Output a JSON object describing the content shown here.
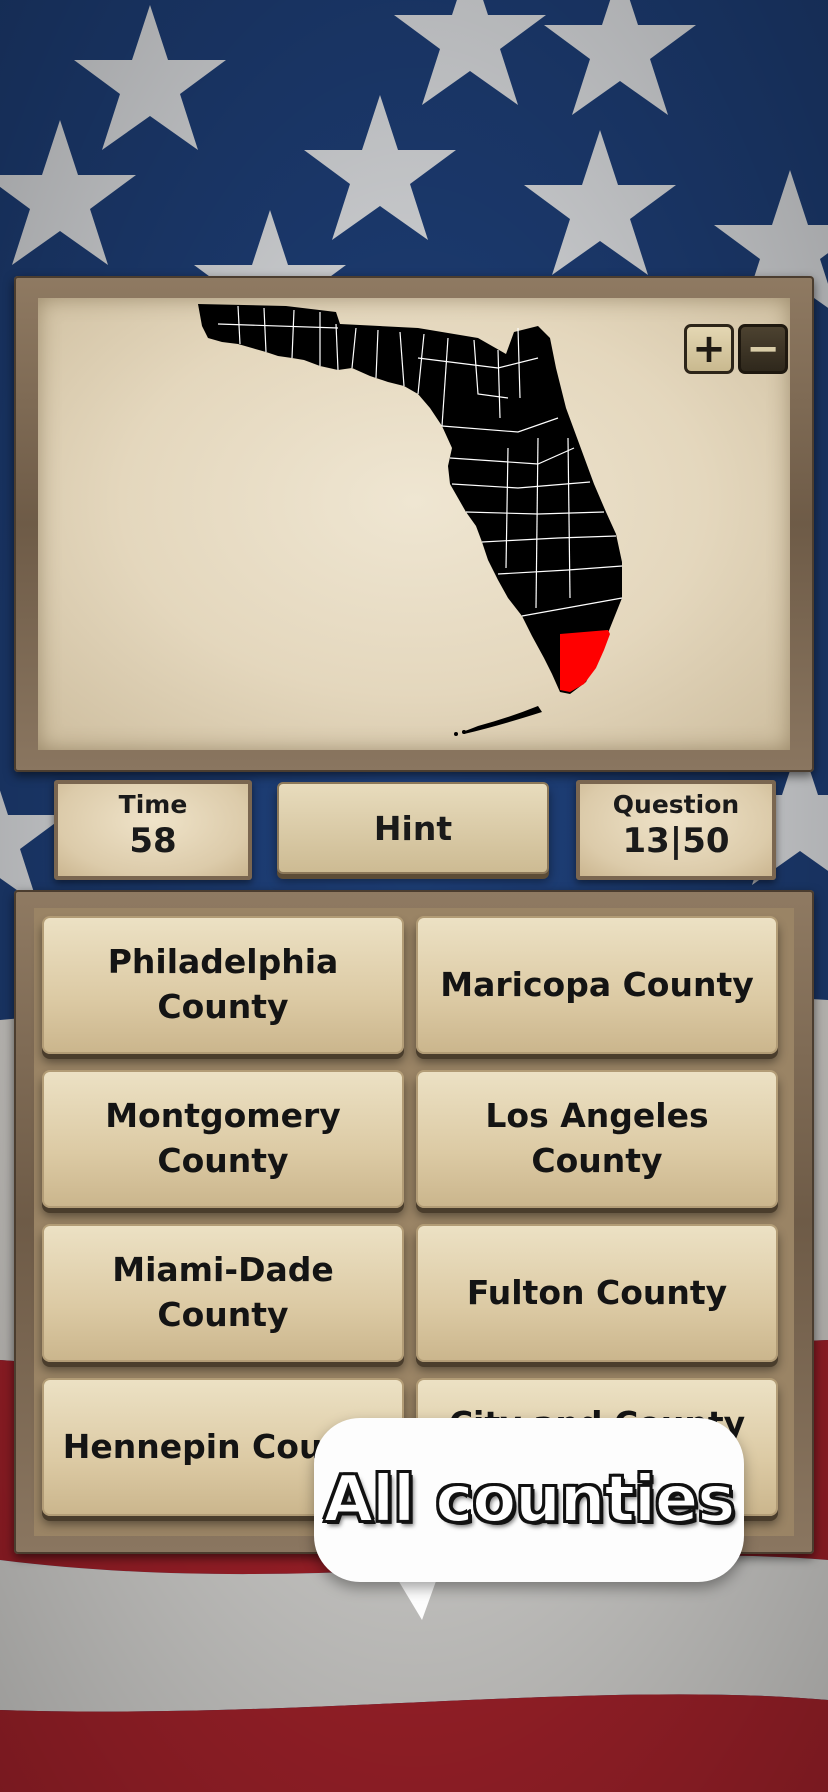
{
  "map": {
    "region": "Florida",
    "highlighted_county": "Miami-Dade County",
    "highlight_color": "#ff0000",
    "land_color": "#000000",
    "border_color": "#ffffff",
    "zoom_in_label": "+",
    "zoom_out_label": "−"
  },
  "stats": {
    "time_label": "Time",
    "time_value": "58",
    "hint_label": "Hint",
    "question_label": "Question",
    "question_value": "13|50"
  },
  "answers": [
    "Philadelphia County",
    "Maricopa County",
    "Montgomery County",
    "Los Angeles County",
    "Miami-Dade County",
    "Fulton County",
    "Hennepin County",
    "City and County of"
  ],
  "bubble": {
    "text": "All counties"
  },
  "colors": {
    "flag_blue": "#1d3f78",
    "flag_red": "#b3232c",
    "flag_white": "#e8e6e2",
    "parchment": "#e4d7bd",
    "wood": "#7a6650"
  }
}
